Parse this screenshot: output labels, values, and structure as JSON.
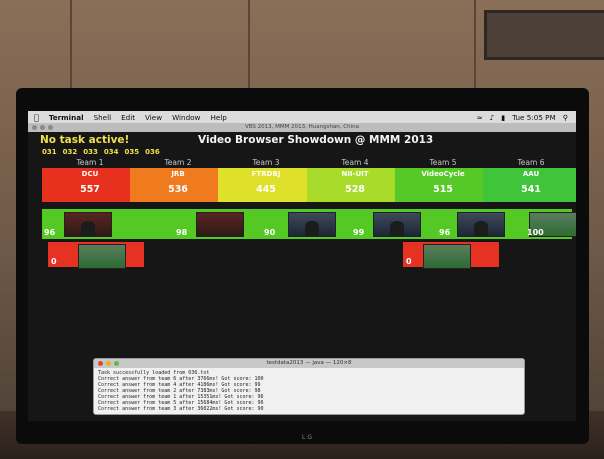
{
  "menubar": {
    "apple_icon": "apple-logo-icon",
    "app_name": "Terminal",
    "items": [
      "Shell",
      "Edit",
      "View",
      "Window",
      "Help"
    ],
    "clock": "Tue 5:05 PM"
  },
  "window": {
    "title": "VBS 2013, MMM 2013, Huangshan, China"
  },
  "header": {
    "status": "No task active!",
    "title": "Video Browser Showdown @ MMM 2013"
  },
  "tasks": [
    "031",
    "032",
    "033",
    "034",
    "035",
    "036"
  ],
  "teams": [
    {
      "label": "Team 1",
      "name": "DCU",
      "score": "557",
      "color": "#e8301f"
    },
    {
      "label": "Team 2",
      "name": "JRB",
      "score": "536",
      "color": "#f07a1e"
    },
    {
      "label": "Team 3",
      "name": "FTRDBJ",
      "score": "445",
      "color": "#dfe02a"
    },
    {
      "label": "Team 4",
      "name": "NII-UIT",
      "score": "528",
      "color": "#a9dc2a"
    },
    {
      "label": "Team 5",
      "name": "VideoCycle",
      "score": "515",
      "color": "#56c928"
    },
    {
      "label": "Team 6",
      "name": "AAU",
      "score": "541",
      "color": "#3fc43a"
    }
  ],
  "submissions": [
    "96",
    "98",
    "90",
    "99",
    "96",
    "100"
  ],
  "misses": [
    {
      "team": "Team 1",
      "value": "0"
    },
    {
      "team": "Team 5",
      "value": "0"
    }
  ],
  "terminal": {
    "title": "testdata2013 — java — 120×8",
    "lines": [
      "Task successfully loaded from 036.txt",
      "Correct answer from team 6 after 3766ms! Got score: 100",
      "Correct answer from team 4 after 4186ms! Got score: 99",
      "Correct answer from team 2 after 7383ms! Got score: 98",
      "Correct answer from team 1 after 15351ms! Got score: 96",
      "Correct answer from team 5 after 15684ms! Got score: 96",
      "Correct answer from team 3 after 36022ms! Got score: 90"
    ]
  },
  "monitor": {
    "brand": "LG"
  }
}
